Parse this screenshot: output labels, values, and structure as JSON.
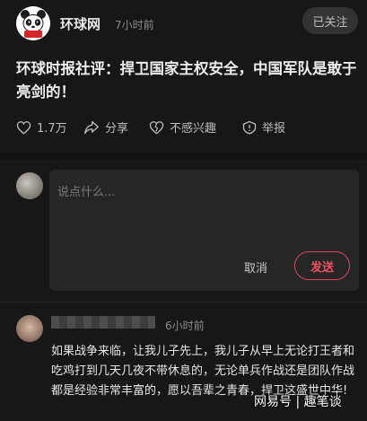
{
  "header": {
    "source_name": "环球网",
    "time_ago": "7小时前",
    "follow_label": "已关注"
  },
  "article": {
    "title": "环球时报社评：捍卫国家主权安全，中国军队是敢于亮剑的！"
  },
  "actions": {
    "like_count": "1.7万",
    "share_label": "分享",
    "dislike_label": "不感兴趣",
    "report_label": "举报"
  },
  "comment_box": {
    "placeholder": "说点什么...",
    "cancel_label": "取消",
    "send_label": "发送"
  },
  "comments": [
    {
      "time_ago": "6小时前",
      "text": "如果战争来临，让我儿子先上，我儿子从早上无论打王者和吃鸡打到几天几夜不带休息的，无论单兵作战还是团队作战都是经验非常丰富的，愿以吾辈之青春，捍卫这盛世中华!"
    }
  ],
  "watermark": "网易号 | 趣笔谈",
  "colors": {
    "background": "#171717",
    "accent": "#e0445a"
  }
}
